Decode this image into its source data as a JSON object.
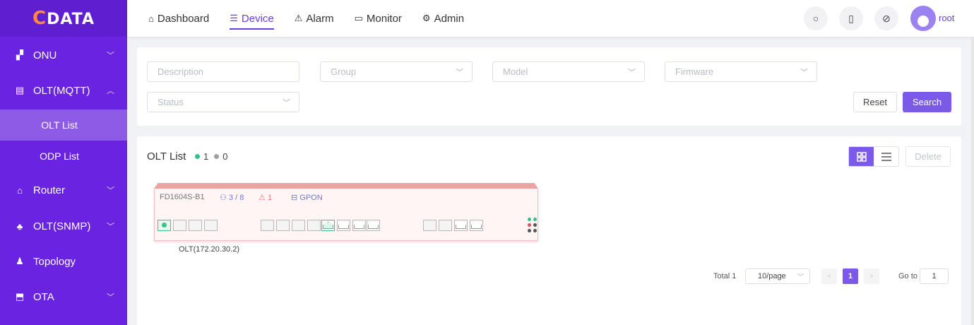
{
  "brand": {
    "logo_text": "DATA",
    "logo_letter": "C"
  },
  "sidebar": {
    "items": [
      {
        "icon": "onu-icon",
        "label": "ONU",
        "chevron": "down"
      },
      {
        "icon": "olt-mqtt-icon",
        "label": "OLT(MQTT)",
        "chevron": "up"
      },
      {
        "icon": "router-icon",
        "label": "Router",
        "chevron": "down"
      },
      {
        "icon": "olt-snmp-icon",
        "label": "OLT(SNMP)",
        "chevron": "down"
      },
      {
        "icon": "topology-icon",
        "label": "Topology",
        "chevron": ""
      },
      {
        "icon": "ota-icon",
        "label": "OTA",
        "chevron": "down"
      }
    ],
    "submenu": [
      {
        "label": "OLT List",
        "active": true
      },
      {
        "label": "ODP List",
        "active": false
      }
    ]
  },
  "header": {
    "nav": [
      {
        "icon": "home-icon",
        "label": "Dashboard",
        "active": false
      },
      {
        "icon": "device-icon",
        "label": "Device",
        "active": true
      },
      {
        "icon": "alarm-icon",
        "label": "Alarm",
        "active": false
      },
      {
        "icon": "monitor-icon",
        "label": "Monitor",
        "active": false
      },
      {
        "icon": "admin-gear-icon",
        "label": "Admin",
        "active": false
      }
    ],
    "username": "root"
  },
  "filters": {
    "description_placeholder": "Description",
    "group_placeholder": "Group",
    "model_placeholder": "Model",
    "firmware_placeholder": "Firmware",
    "status_placeholder": "Status",
    "reset_label": "Reset",
    "search_label": "Search"
  },
  "olt_list": {
    "title": "OLT List",
    "online_count": "1",
    "offline_count": "0",
    "delete_label": "Delete",
    "colors": {
      "online": "#2ec28e",
      "offline": "#a0a0a0",
      "accent": "#7b5ae8"
    },
    "devices": [
      {
        "model": "FD1604S-B1",
        "ports": "3 / 8",
        "alarms": "1",
        "type": "GPON",
        "name": "OLT(172.20.30.2)"
      }
    ]
  },
  "pagination": {
    "total": "Total 1",
    "page_size": "10/page",
    "current_page": "1",
    "goto_label": "Go to",
    "goto_value": "1"
  }
}
